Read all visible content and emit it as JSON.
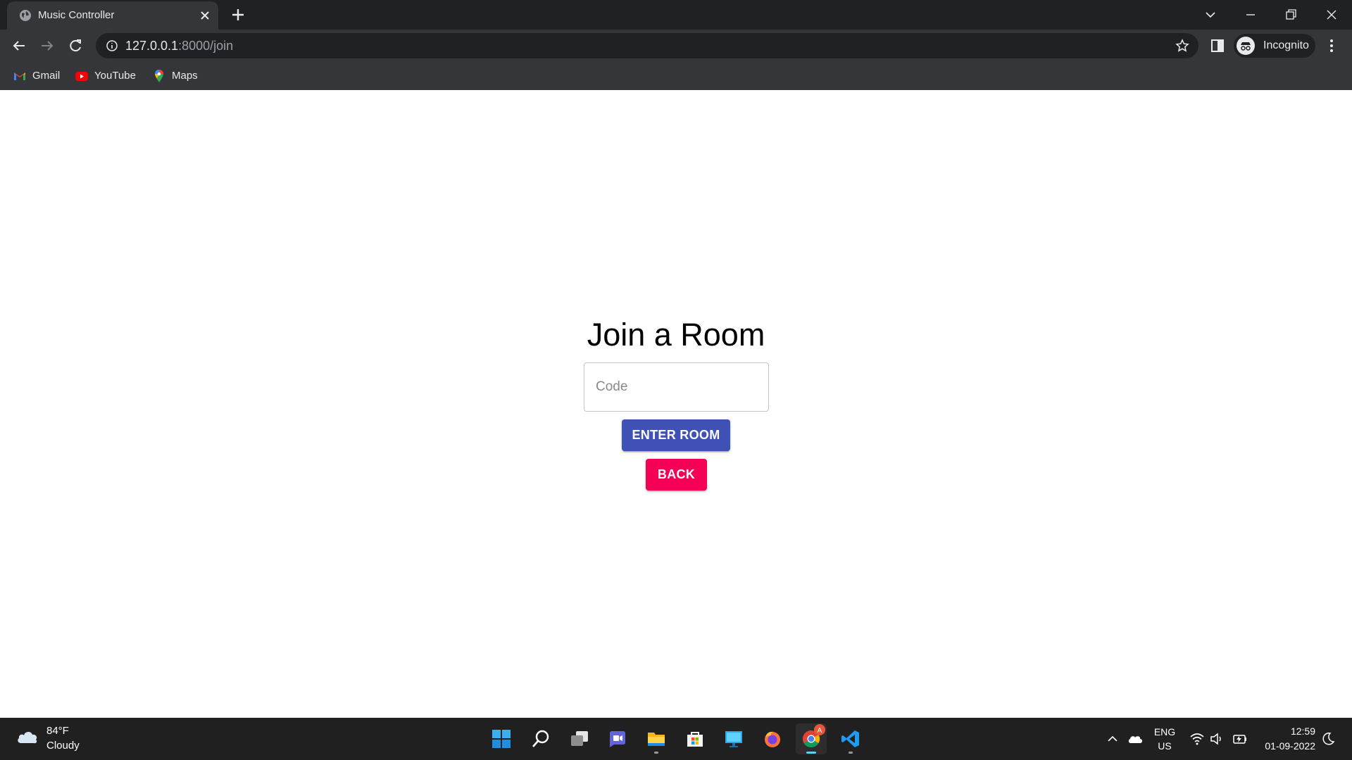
{
  "browser": {
    "tab_title": "Music Controller",
    "url_host": "127.0.0.1",
    "url_rest": ":8000/join",
    "profile_label": "Incognito",
    "bookmarks": [
      {
        "label": "Gmail",
        "icon": "gmail-icon"
      },
      {
        "label": "YouTube",
        "icon": "youtube-icon"
      },
      {
        "label": "Maps",
        "icon": "maps-icon"
      }
    ]
  },
  "page": {
    "heading": "Join a Room",
    "code_placeholder": "Code",
    "code_value": "",
    "enter_button": "ENTER ROOM",
    "back_button": "BACK",
    "colors": {
      "primary": "#3f51b5",
      "secondary": "#f50057"
    }
  },
  "taskbar": {
    "weather_temp": "84°F",
    "weather_condition": "Cloudy",
    "apps": [
      "start-icon",
      "search-icon",
      "task-view-icon",
      "chat-icon",
      "file-explorer-icon",
      "store-icon",
      "remote-desktop-icon",
      "firefox-icon",
      "chrome-icon",
      "vscode-icon"
    ],
    "chrome_badge": "A",
    "language_line1": "ENG",
    "language_line2": "US",
    "time": "12:59",
    "date": "01-09-2022"
  }
}
